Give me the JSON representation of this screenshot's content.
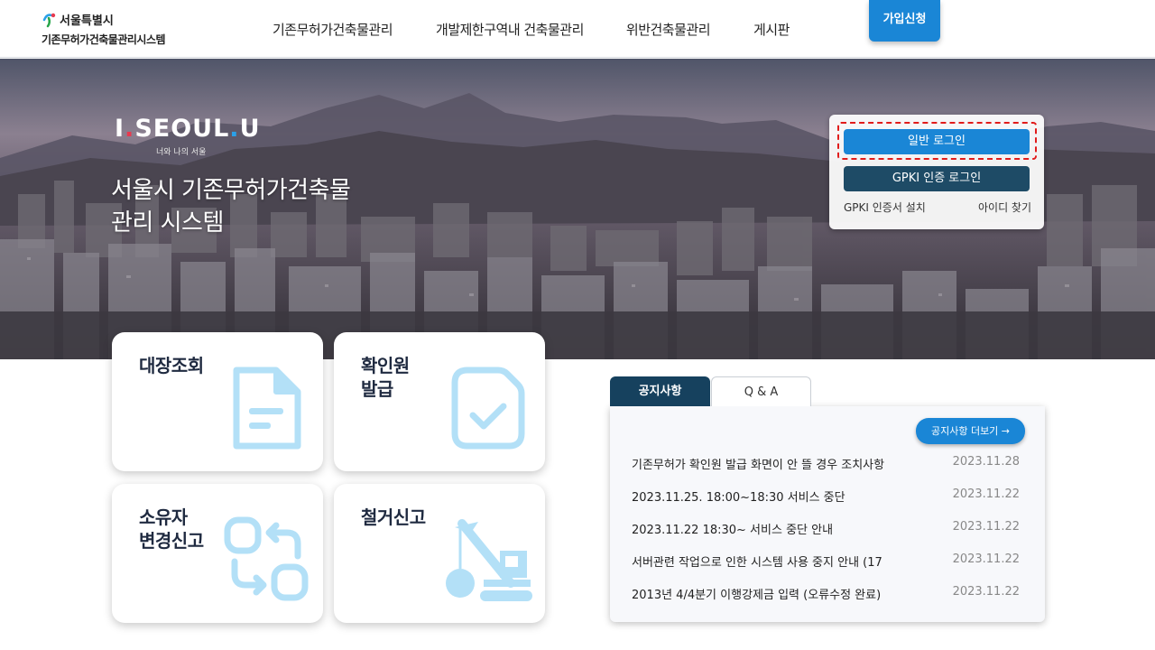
{
  "header": {
    "logo_line1": "서울특별시",
    "logo_line2": "기존무허가건축물관리시스템",
    "nav": [
      "기존무허가건축물관리",
      "개발제한구역내 건축물관리",
      "위반건축물관리",
      "게시판"
    ],
    "join_label": "가입신청"
  },
  "hero": {
    "brand_i": "I",
    "brand_seoul": "SEOUL",
    "brand_u": "U",
    "brand_sub": "너와 나의 서울",
    "title_line1": "서울시 기존무허가건축물",
    "title_line2": "관리 시스템"
  },
  "login": {
    "general_login": "일반 로그인",
    "gpki_login": "GPKI 인증 로그인",
    "gpki_install": "GPKI 인증서 설치",
    "find_id": "아이디 찾기"
  },
  "cards": [
    {
      "line1": "대장조회",
      "line2": "",
      "icon": "document-icon"
    },
    {
      "line1": "확인원",
      "line2": "발급",
      "icon": "document-check-icon"
    },
    {
      "line1": "소유자",
      "line2": "변경신고",
      "icon": "swap-icon"
    },
    {
      "line1": "철거신고",
      "line2": "",
      "icon": "crane-icon"
    }
  ],
  "notice": {
    "tabs": [
      "공지사항",
      "Q & A"
    ],
    "more_label": "공지사항 더보기 →",
    "items": [
      {
        "title": "기존무허가 확인원 발급 화면이 안 뜰 경우 조치사항",
        "date": "2023.11.28"
      },
      {
        "title": "2023.11.25. 18:00~18:30 서비스 중단",
        "date": "2023.11.22"
      },
      {
        "title": "2023.11.22 18:30~ 서비스 중단 안내",
        "date": "2023.11.22"
      },
      {
        "title": "서버관련 작업으로 인한 시스템 사용 중지 안내 (17",
        "date": "2023.11.22"
      },
      {
        "title": "2013년 4/4분기 이행강제금 입력 (오류수정 완료)",
        "date": "2023.11.22"
      }
    ]
  },
  "colors": {
    "accent": "#1a86d6",
    "dark_navy": "#16415e",
    "icon_light_blue": "#b3e0f7",
    "highlight_red": "#e11b1b"
  }
}
